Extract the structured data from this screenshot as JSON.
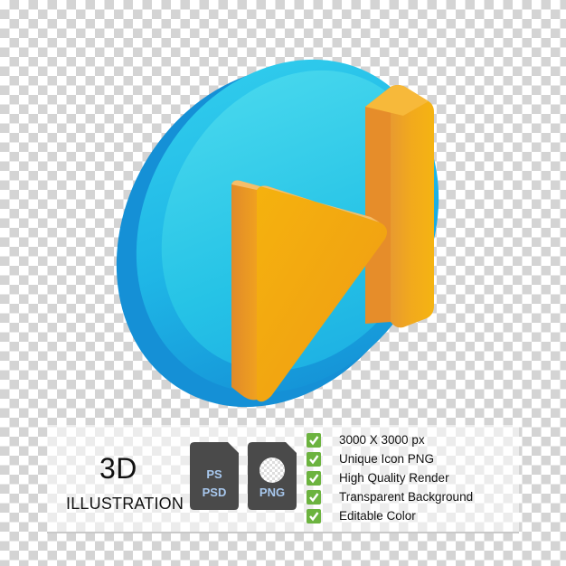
{
  "illustration": {
    "subject": "next-track-button-icon",
    "colors": {
      "disc": "#1eb4e6",
      "disc_highlight": "#2fd6ea",
      "shape": "#f2a516",
      "shape_side": "#e48a24"
    }
  },
  "info": {
    "title": "3D",
    "subtitle": "ILLUSTRATION",
    "files": [
      {
        "icon": "psd-file-icon",
        "line1": "PS",
        "line2": "PSD"
      },
      {
        "icon": "png-file-icon",
        "line1": "",
        "line2": "PNG"
      }
    ],
    "features": [
      {
        "icon": "check-icon",
        "label": "3000 X 3000 px"
      },
      {
        "icon": "check-icon",
        "label": "Unique Icon PNG"
      },
      {
        "icon": "check-icon",
        "label": "High Quality Render"
      },
      {
        "icon": "check-icon",
        "label": "Transparent Background"
      },
      {
        "icon": "check-icon",
        "label": "Editable Color"
      }
    ],
    "colors": {
      "check": "#6cb33f",
      "file_bg": "#4a4a4a",
      "file_text": "#a8c8ee"
    }
  }
}
